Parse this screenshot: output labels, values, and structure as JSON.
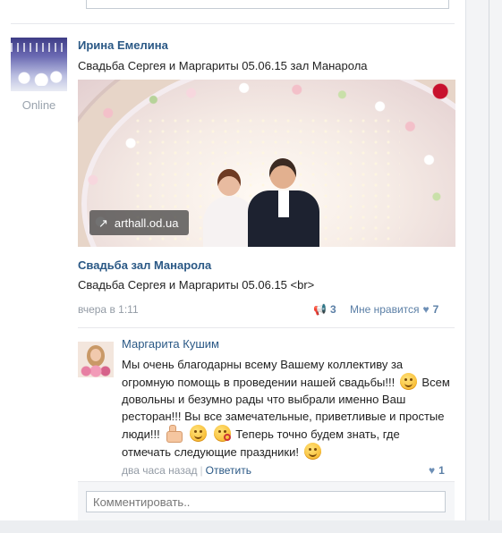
{
  "post": {
    "author": "Ирина Емелина",
    "status": "Online",
    "text": "Свадьба Сергея и Маргариты 05.06.15 зал Манарола",
    "image": {
      "badge_icon": "link-icon",
      "badge_text": "arthall.od.ua"
    },
    "share_title": "Свадьба зал Манарола",
    "share_description": "Свадьба Сергея и Маргариты 05.06.15 <br>",
    "time": "вчера в 1:11",
    "reposts": "3",
    "like_label": "Мне нравится",
    "likes": "7"
  },
  "comment": {
    "author": "Маргарита Кушим",
    "text_parts": [
      "Мы очень благодарны всему Вашему коллективу за огромную помощь в проведении нашей свадьбы!!! ",
      " Всем довольны и безумно рады что выбрали именно Ваш ресторан!!! Вы все замечательные, приветливые и простые люди!!! ",
      " Теперь точно будем знать, где отмечать следующие праздники! "
    ],
    "time": "два часа назад",
    "separator": "|",
    "reply_label": "Ответить",
    "likes": "1"
  },
  "compose": {
    "placeholder": "Комментировать.."
  },
  "colors": {
    "link": "#2a5885",
    "muted": "#939ba5",
    "action": "#5b7fa6"
  }
}
